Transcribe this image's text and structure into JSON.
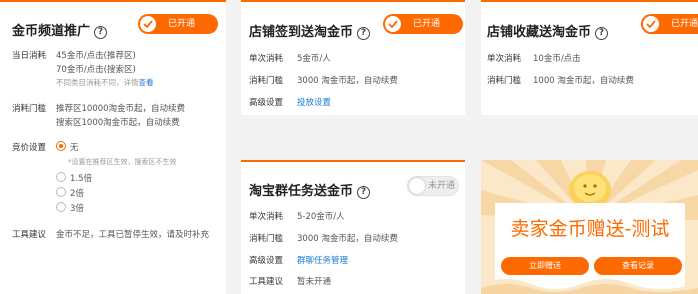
{
  "card1": {
    "title": "金币频道推广",
    "toggle": "已开通",
    "today_label": "当日消耗",
    "today_line1": "45金币/点击(推荐区)",
    "today_line2": "70金币/点击(搜索区)",
    "today_line3": "不同类目消耗不同，详情",
    "today_link": "查看",
    "threshold_label": "消耗门槛",
    "threshold_line1": "推荐区10000淘金币起，自动续费",
    "threshold_line2": "搜索区1000淘金币起，自动续费",
    "bid_label": "竞价设置",
    "bid_options": [
      "无",
      "1.5倍",
      "2倍",
      "3倍"
    ],
    "bid_hint": "*设置在推荐区生效，搜索区不生效",
    "tool_label": "工具建议",
    "tool_value": "金币不足，工具已暂停生效，请及时补充"
  },
  "card2": {
    "title": "店铺签到送淘金币",
    "toggle": "已开通",
    "single_label": "单次消耗",
    "single_value": "5金币/人",
    "threshold_label": "消耗门槛",
    "threshold_value": "3000 淘金币起，自动续费",
    "adv_label": "高级设置",
    "adv_link": "投放设置"
  },
  "card3": {
    "title": "店铺收藏送淘金币",
    "toggle": "已开通",
    "single_label": "单次消耗",
    "single_value": "10金币/点击",
    "threshold_label": "消耗门槛",
    "threshold_value": "1000 淘金币起，自动续费"
  },
  "card4": {
    "title": "淘宝群任务送金币",
    "toggle": "未开通",
    "single_label": "单次消耗",
    "single_value": "5-20金币/人",
    "threshold_label": "消耗门槛",
    "threshold_value": "3000 淘金币起，自动续费",
    "adv_label": "高级设置",
    "adv_link": "群聊任务管理",
    "tool_label": "工具建议",
    "tool_value": "暂未开通"
  },
  "promo": {
    "title": "卖家金币赠送-测试",
    "btn_gift": "立即赠送",
    "btn_records": "查看记录"
  },
  "colors": {
    "accent": "#ff6a00",
    "link": "#1a7bd6",
    "page_bg": "#f3f3f3"
  }
}
